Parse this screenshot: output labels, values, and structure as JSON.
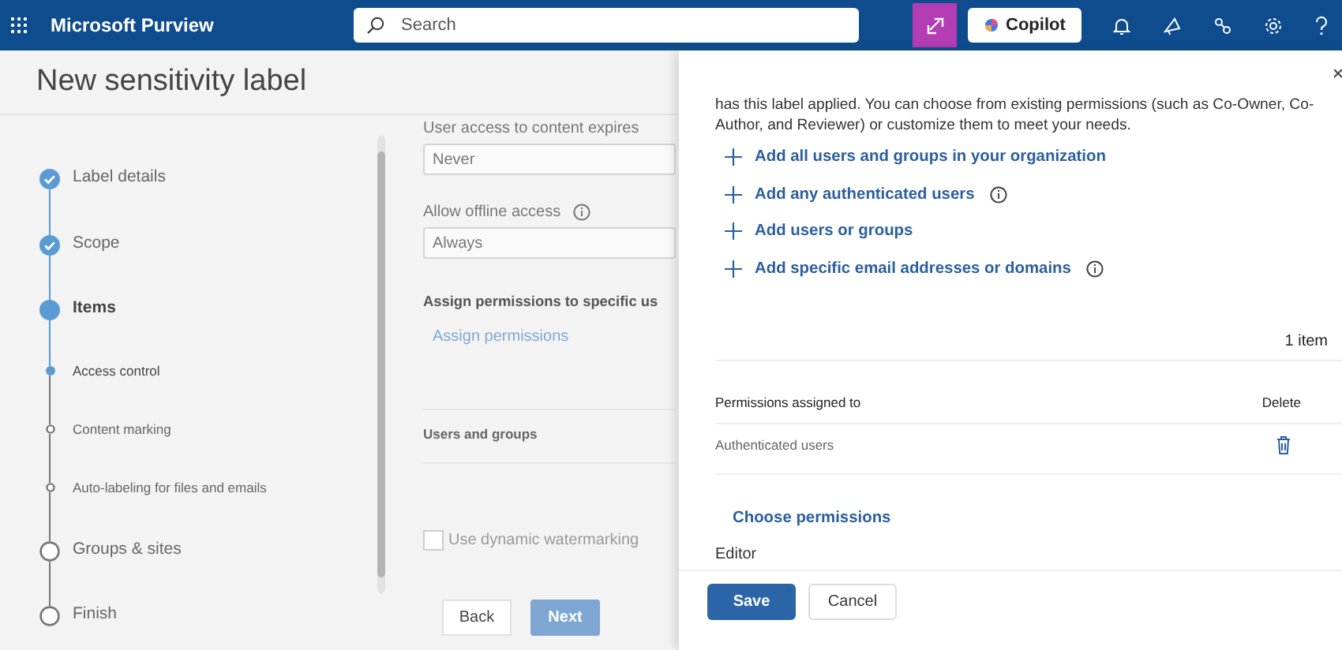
{
  "header": {
    "app_name": "Microsoft Purview",
    "search": {
      "placeholder": "Search"
    },
    "copilot": "Copilot"
  },
  "page": {
    "title": "New sensitivity label",
    "steps": [
      {
        "label": "Label details",
        "kind": "step",
        "completed": true,
        "current": false
      },
      {
        "label": "Scope",
        "kind": "step",
        "completed": true,
        "current": false
      },
      {
        "label": "Items",
        "kind": "step",
        "completed": false,
        "current": true
      },
      {
        "label": "Access control",
        "kind": "substep",
        "completed": false,
        "current": true
      },
      {
        "label": "Content marking",
        "kind": "substep",
        "completed": false,
        "current": false
      },
      {
        "label": "Auto-labeling for files and emails",
        "kind": "substep",
        "completed": false,
        "current": false
      },
      {
        "label": "Groups & sites",
        "kind": "step",
        "completed": false,
        "current": false
      },
      {
        "label": "Finish",
        "kind": "step",
        "completed": false,
        "current": false
      }
    ],
    "form": {
      "expires_label": "User access to content expires",
      "expires_value": "Never",
      "offline_label": "Allow offline access",
      "offline_value": "Always",
      "assign_heading": "Assign permissions to specific us",
      "assign_link": "Assign permissions",
      "users_groups": "Users and groups",
      "watermark": {
        "label": "Use dynamic watermarking",
        "checked": false
      }
    },
    "buttons": [
      "Back",
      "Next"
    ]
  },
  "panel": {
    "intro": "has this label applied. You can choose from existing permissions (such as Co-Owner, Co-Author, and Reviewer) or customize them to meet your needs.",
    "add_links": [
      {
        "label": "Add all users and groups in your organization",
        "info": false
      },
      {
        "label": "Add any authenticated users",
        "info": true
      },
      {
        "label": "Add users or groups",
        "info": false
      },
      {
        "label": "Add specific email addresses or domains",
        "info": true
      }
    ],
    "count": "1 item",
    "table": {
      "columns": [
        "Permissions assigned to",
        "Delete"
      ],
      "rows": [
        {
          "name": "Authenticated users"
        }
      ]
    },
    "choose": "Choose permissions",
    "permission": "Editor",
    "buttons": [
      "Save",
      "Cancel"
    ]
  }
}
